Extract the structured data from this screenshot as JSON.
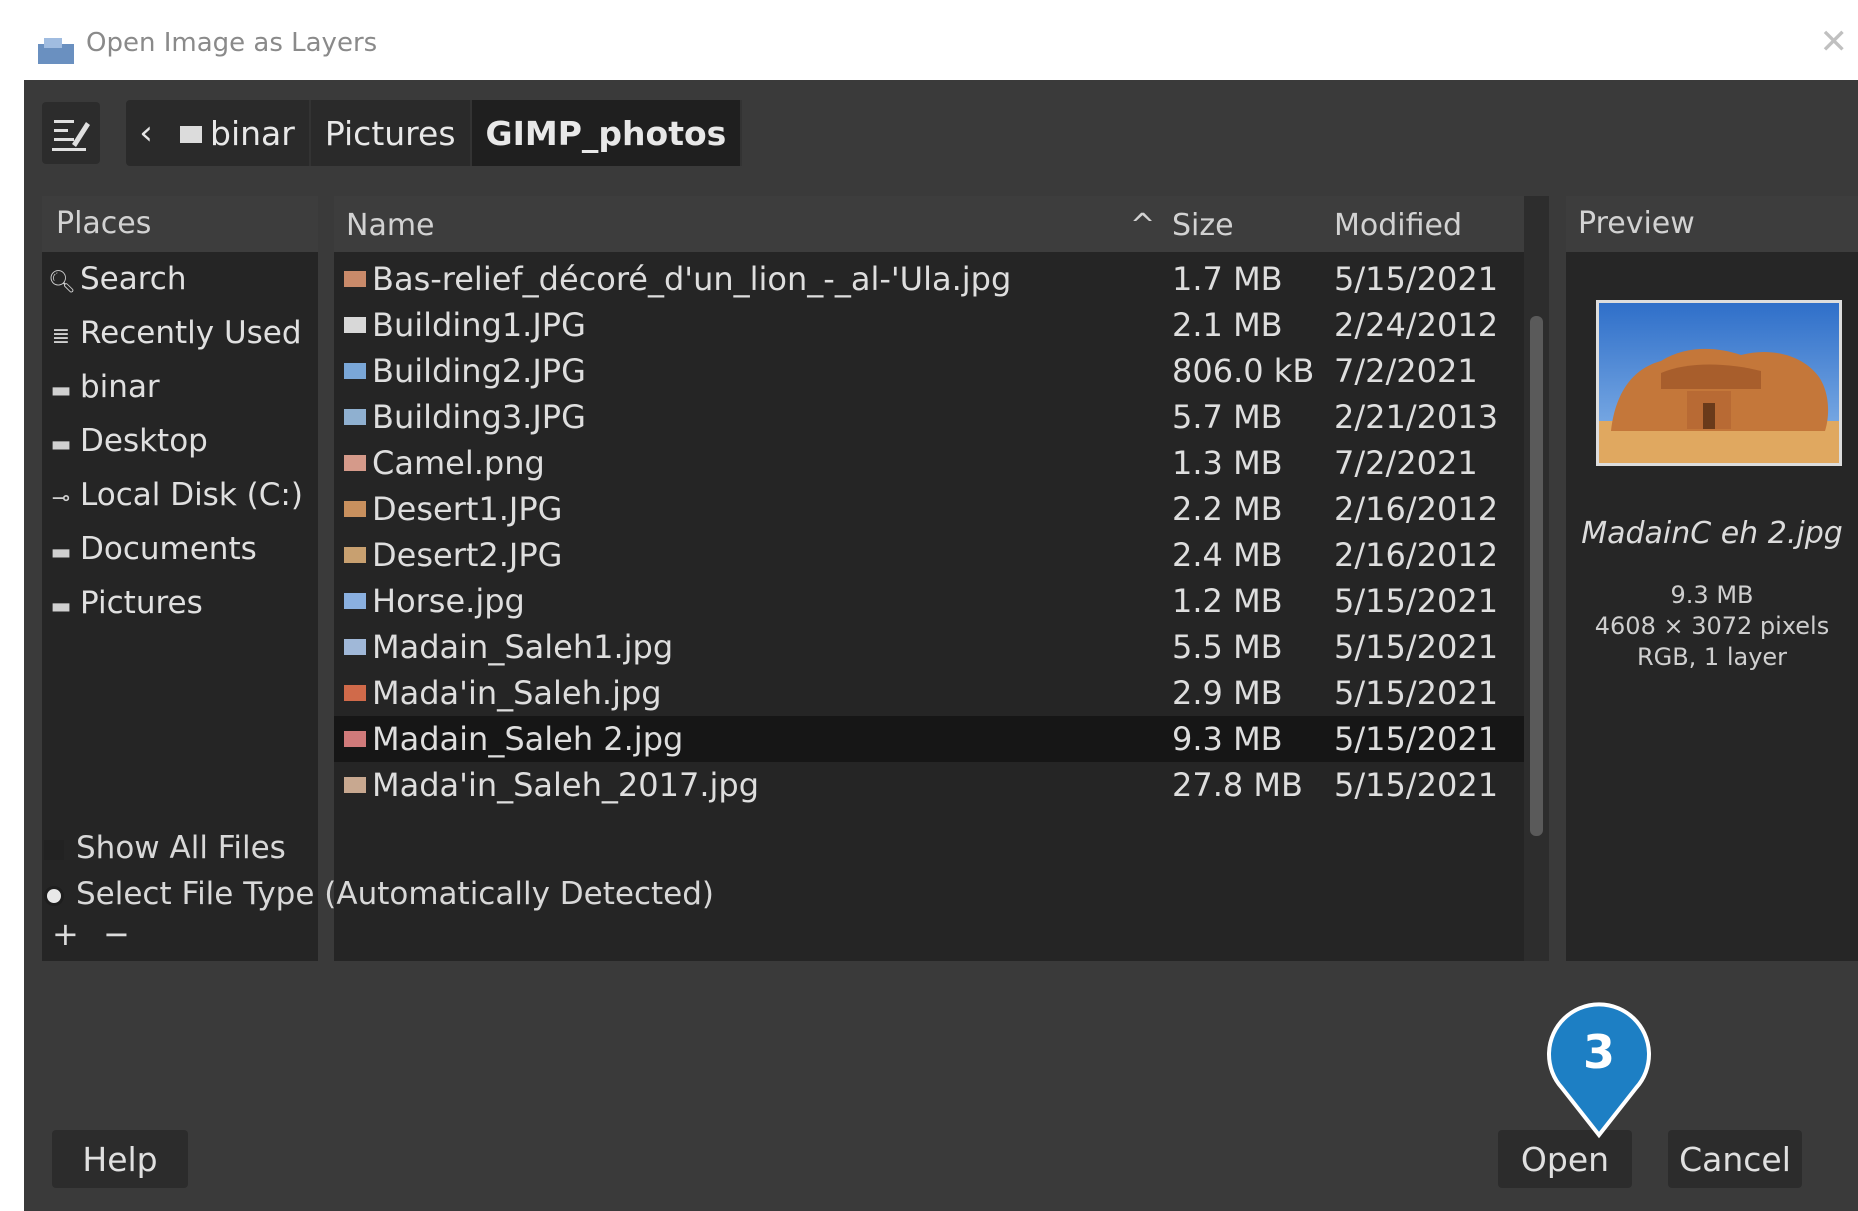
{
  "window": {
    "title": "Open Image as Layers",
    "close_label": "✕"
  },
  "breadcrumb": {
    "back_label": "‹",
    "items": [
      "binar",
      "Pictures",
      "GIMP_photos"
    ]
  },
  "places": {
    "header": "Places",
    "items": [
      {
        "icon": "search-icon",
        "label": "Search"
      },
      {
        "icon": "recent-icon",
        "label": "Recently Used"
      },
      {
        "icon": "folder-icon",
        "label": "binar"
      },
      {
        "icon": "folder-icon",
        "label": "Desktop"
      },
      {
        "icon": "drive-icon",
        "label": "Local Disk (C:)"
      },
      {
        "icon": "folder-icon",
        "label": "Documents"
      },
      {
        "icon": "folder-icon",
        "label": "Pictures"
      }
    ],
    "add_label": "+",
    "remove_label": "−"
  },
  "files": {
    "columns": {
      "name": "Name",
      "size": "Size",
      "modified": "Modified"
    },
    "sort_indicator": "^",
    "rows": [
      {
        "name": "Bas-relief_décoré_d'un_lion_-_al-'Ula.jpg",
        "size": "1.7 MB",
        "modified": "5/15/2021",
        "color": "#c98a6a",
        "selected": false
      },
      {
        "name": "Building1.JPG",
        "size": "2.1 MB",
        "modified": "2/24/2012",
        "color": "#d8d8d8",
        "selected": false
      },
      {
        "name": "Building2.JPG",
        "size": "806.0 kB",
        "modified": "7/2/2021",
        "color": "#7aa7d8",
        "selected": false
      },
      {
        "name": "Building3.JPG",
        "size": "5.7 MB",
        "modified": "2/21/2013",
        "color": "#8fb0d0",
        "selected": false
      },
      {
        "name": "Camel.png",
        "size": "1.3 MB",
        "modified": "7/2/2021",
        "color": "#d59a8a",
        "selected": false
      },
      {
        "name": "Desert1.JPG",
        "size": "2.2 MB",
        "modified": "2/16/2012",
        "color": "#c8905e",
        "selected": false
      },
      {
        "name": "Desert2.JPG",
        "size": "2.4 MB",
        "modified": "2/16/2012",
        "color": "#c8a070",
        "selected": false
      },
      {
        "name": "Horse.jpg",
        "size": "1.2 MB",
        "modified": "5/15/2021",
        "color": "#8ab0e0",
        "selected": false
      },
      {
        "name": "Madain_Saleh1.jpg",
        "size": "5.5 MB",
        "modified": "5/15/2021",
        "color": "#a0b8d8",
        "selected": false
      },
      {
        "name": "Mada'in_Saleh.jpg",
        "size": "2.9 MB",
        "modified": "5/15/2021",
        "color": "#d06a4a",
        "selected": false
      },
      {
        "name": "Madain_Saleh 2.jpg",
        "size": "9.3 MB",
        "modified": "5/15/2021",
        "color": "#d07a7a",
        "selected": true
      },
      {
        "name": "Mada'in_Saleh_2017.jpg",
        "size": "27.8 MB",
        "modified": "5/15/2021",
        "color": "#c8a890",
        "selected": false
      }
    ]
  },
  "preview": {
    "header": "Preview",
    "filename": "MadainC eh 2.jpg",
    "size": "9.3 MB",
    "dimensions": "4608 × 3072 pixels",
    "mode": "RGB, 1 layer"
  },
  "options": {
    "show_all_files": "Show All Files",
    "file_type": "Select File Type (Automatically Detected)"
  },
  "buttons": {
    "help": "Help",
    "open": "Open",
    "cancel": "Cancel"
  },
  "callout": {
    "number": "3",
    "color": "#1d7fc4"
  }
}
